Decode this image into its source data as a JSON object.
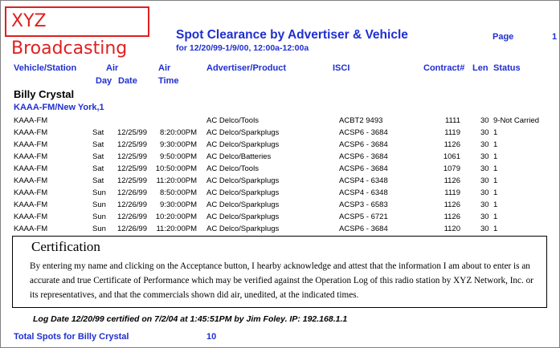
{
  "logo": "XYZ Broadcasting",
  "report": {
    "title": "Spot Clearance by Advertiser & Vehicle",
    "subtitle": "for 12/20/99-1/9/00, 12:00a-12:00a",
    "page_label": "Page",
    "page_number": "1"
  },
  "columns": {
    "vehicle": "Vehicle/Station",
    "air_day_1": "Air",
    "air_day_2": "Day",
    "air_date_1": "Air",
    "air_date_2": "Date",
    "air_time": "Time",
    "advertiser": "Advertiser/Product",
    "isci": "ISCI",
    "contract": "Contract#",
    "len": "Len",
    "status": "Status"
  },
  "advertiser_name": "Billy Crystal",
  "station_group": "KAAA-FM/New York,1",
  "rows": [
    {
      "station": "KAAA-FM",
      "day": "",
      "date": "",
      "time": "",
      "product": "AC Delco/Tools",
      "isci": "ACBT2 9493",
      "contract": "1111",
      "len": "30",
      "status": "9-Not Carried"
    },
    {
      "station": "KAAA-FM",
      "day": "Sat",
      "date": "12/25/99",
      "time": "8:20:00PM",
      "product": "AC Delco/Sparkplugs",
      "isci": "ACSP6 - 3684",
      "contract": "1119",
      "len": "30",
      "status": "1"
    },
    {
      "station": "KAAA-FM",
      "day": "Sat",
      "date": "12/25/99",
      "time": "9:30:00PM",
      "product": "AC Delco/Sparkplugs",
      "isci": "ACSP6 - 3684",
      "contract": "1126",
      "len": "30",
      "status": "1"
    },
    {
      "station": "KAAA-FM",
      "day": "Sat",
      "date": "12/25/99",
      "time": "9:50:00PM",
      "product": "AC Delco/Batteries",
      "isci": "ACSP6 - 3684",
      "contract": "1061",
      "len": "30",
      "status": "1"
    },
    {
      "station": "KAAA-FM",
      "day": "Sat",
      "date": "12/25/99",
      "time": "10:50:00PM",
      "product": "AC Delco/Tools",
      "isci": "ACSP6 - 3684",
      "contract": "1079",
      "len": "30",
      "status": "1"
    },
    {
      "station": "KAAA-FM",
      "day": "Sat",
      "date": "12/25/99",
      "time": "11:20:00PM",
      "product": "AC Delco/Sparkplugs",
      "isci": "ACSP4 - 6348",
      "contract": "1126",
      "len": "30",
      "status": "1"
    },
    {
      "station": "KAAA-FM",
      "day": "Sun",
      "date": "12/26/99",
      "time": "8:50:00PM",
      "product": "AC Delco/Sparkplugs",
      "isci": "ACSP4 - 6348",
      "contract": "1119",
      "len": "30",
      "status": "1"
    },
    {
      "station": "KAAA-FM",
      "day": "Sun",
      "date": "12/26/99",
      "time": "9:30:00PM",
      "product": "AC Delco/Sparkplugs",
      "isci": "ACSP3 - 6583",
      "contract": "1126",
      "len": "30",
      "status": "1"
    },
    {
      "station": "KAAA-FM",
      "day": "Sun",
      "date": "12/26/99",
      "time": "10:20:00PM",
      "product": "AC Delco/Sparkplugs",
      "isci": "ACSP5 - 6721",
      "contract": "1126",
      "len": "30",
      "status": "1"
    },
    {
      "station": "KAAA-FM",
      "day": "Sun",
      "date": "12/26/99",
      "time": "11:20:00PM",
      "product": "AC Delco/Sparkplugs",
      "isci": "ACSP6 - 3684",
      "contract": "1120",
      "len": "30",
      "status": "1"
    }
  ],
  "certification": {
    "title": "Certification",
    "body": "By entering my name and clicking on the Acceptance button, I hearby acknowledge and attest that the information I am about to enter is an accurate and true Certificate of Performance which may be verified against the Operation Log of this radio station by XYZ Network, Inc. or its representatives, and that the commercials  shown did air, unedited, at the indicated times."
  },
  "log_line": "Log Date 12/20/99 certified on 7/2/04 at    1:45:51PM by Jim Foley. IP: 192.168.1.1",
  "total": {
    "label": "Total Spots for Billy Crystal",
    "value": "10"
  }
}
